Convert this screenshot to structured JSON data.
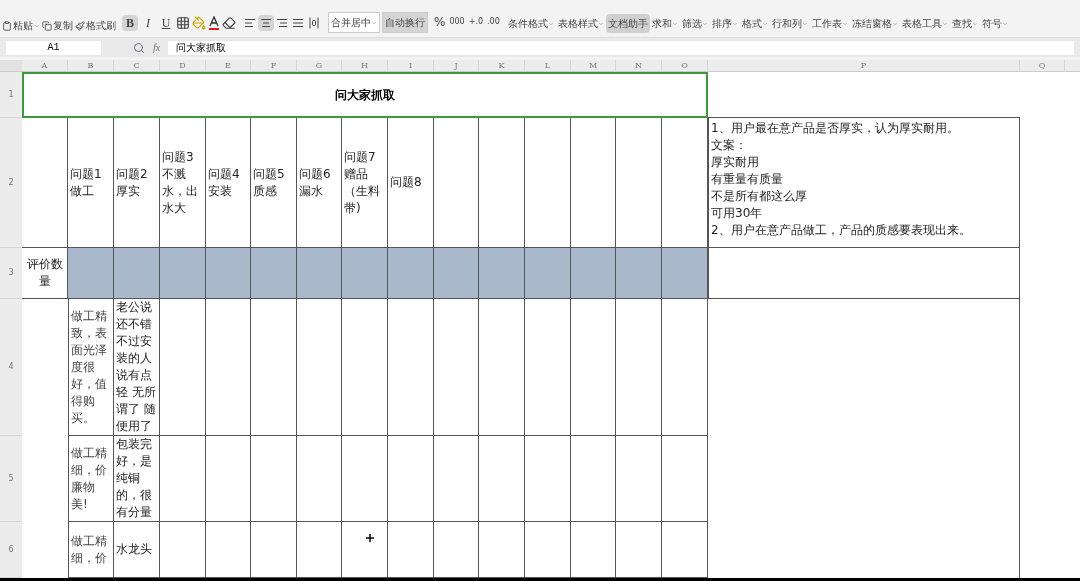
{
  "ribbon": {
    "clipboard": [
      {
        "label": "粘贴",
        "dropdown": true
      },
      {
        "label": "复制",
        "dropdown": false
      },
      {
        "label": "格式刷",
        "dropdown": false
      }
    ],
    "text_format": [
      {
        "label": "B",
        "selected": true
      },
      {
        "label": "I",
        "selected": false
      },
      {
        "label": "U",
        "selected": false
      }
    ],
    "alignment": [
      {
        "selected": false
      },
      {
        "selected": true
      },
      {
        "selected": false
      },
      {
        "selected": false
      },
      {
        "selected": false
      }
    ],
    "merge": [
      {
        "label": "合并居中",
        "dropdown": true,
        "selected": false
      },
      {
        "label": "自动换行",
        "dropdown": false,
        "selected": true
      }
    ],
    "number": {
      "percent": "%",
      "thousands": "000",
      "inc_decimal": "+.0",
      "dec_decimal": ".00"
    },
    "tools": [
      {
        "label": "条件格式",
        "dropdown": true,
        "selected": false
      },
      {
        "label": "表格样式",
        "dropdown": true,
        "selected": false
      },
      {
        "label": "文档助手",
        "dropdown": false,
        "selected": true
      },
      {
        "label": "求和",
        "dropdown": true,
        "selected": false
      },
      {
        "label": "筛选",
        "dropdown": true,
        "selected": false
      },
      {
        "label": "排序",
        "dropdown": true,
        "selected": false
      },
      {
        "label": "格式",
        "dropdown": true,
        "selected": false
      },
      {
        "label": "行和列",
        "dropdown": true,
        "selected": false
      },
      {
        "label": "工作表",
        "dropdown": true,
        "selected": false
      },
      {
        "label": "冻结窗格",
        "dropdown": true,
        "selected": false
      },
      {
        "label": "表格工具",
        "dropdown": true,
        "selected": false
      },
      {
        "label": "查找",
        "dropdown": true,
        "selected": false
      },
      {
        "label": "符号",
        "dropdown": true,
        "selected": false
      }
    ]
  },
  "formula_bar": {
    "name_box": "A1",
    "fx": "fx",
    "value": "问大家抓取"
  },
  "sheet": {
    "columns": [
      "A",
      "B",
      "C",
      "D",
      "E",
      "F",
      "G",
      "H",
      "I",
      "J",
      "K",
      "L",
      "M",
      "N",
      "O",
      "P",
      "Q"
    ],
    "row_numbers": [
      "1",
      "2",
      "3",
      "4",
      "5",
      "6"
    ],
    "title": "问大家抓取",
    "questions": [
      "问题1做工",
      "问题2厚实",
      "问题3不溅水，出水大",
      "问题4安装",
      "问题5质感",
      "问题6漏水",
      "问题7赠品（生料带)",
      "问题8"
    ],
    "notes": [
      "1、用户最在意产品是否厚实，认为厚实耐用。",
      "文案：",
      "厚实耐用",
      "有重量有质量",
      "不是所有都这么厚",
      "可用30年",
      "2、用户在意产品做工，产品的质感要表现出来。"
    ],
    "count_label": "评价数量",
    "reviews": [
      {
        "b": "做工精致，表面光泽度很好，值得购买。",
        "c": "老公说还不错不过安装的人说有点轻 无所谓了 随便用了"
      },
      {
        "b": "做工精细，价廉物美!",
        "c": "包装完好，是纯铜的，很有分量"
      },
      {
        "b": "做工精细，价",
        "c": "水龙头"
      }
    ]
  }
}
